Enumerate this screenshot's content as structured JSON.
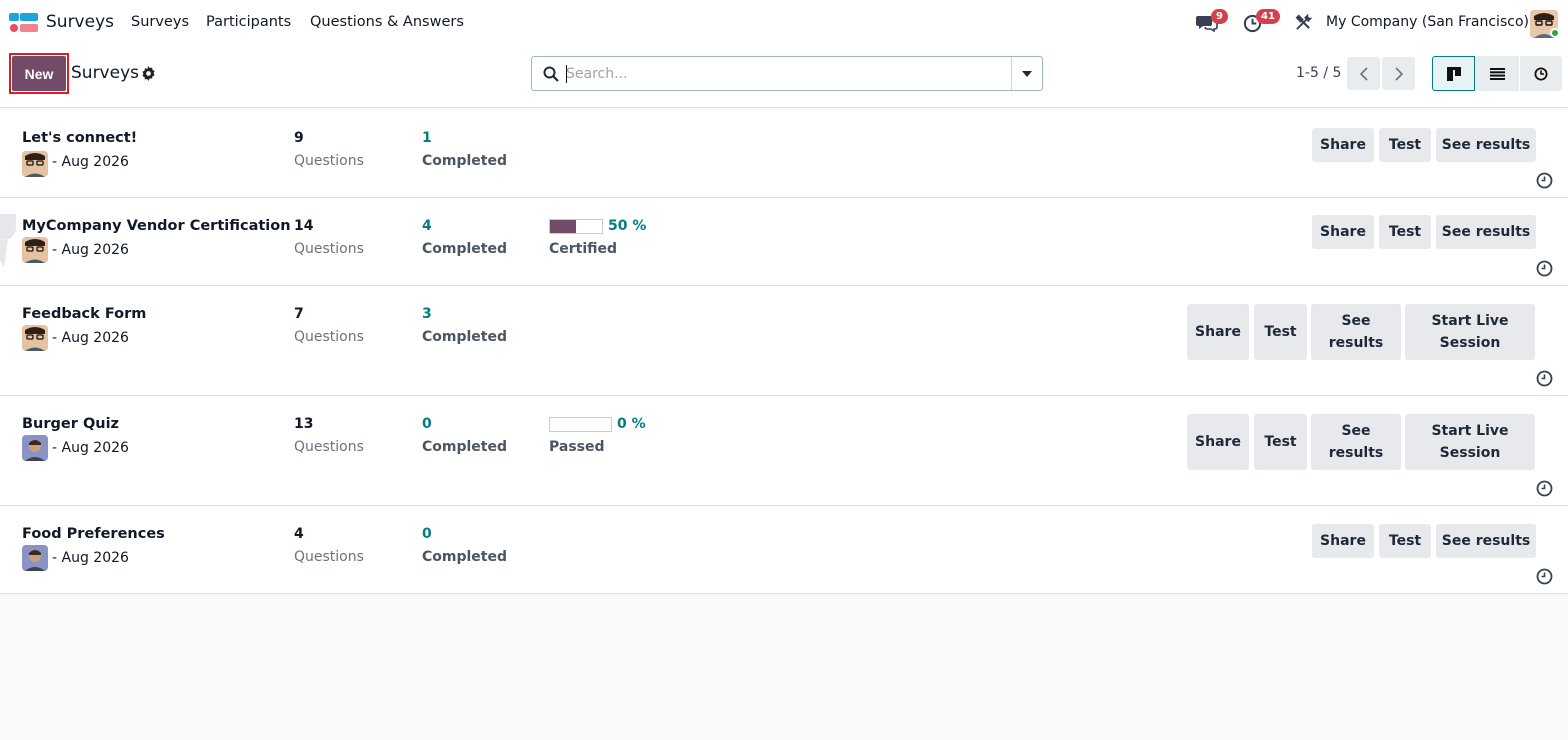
{
  "navbar": {
    "app_name": "Surveys",
    "menu": [
      "Surveys",
      "Participants",
      "Questions & Answers"
    ],
    "messages_count": "9",
    "activities_count": "41",
    "company": "My Company (San Francisco)"
  },
  "control": {
    "new_label": "New",
    "breadcrumb": "Surveys",
    "search_placeholder": "Search...",
    "pager": "1-5 / 5"
  },
  "records": [
    {
      "title": "Let's connect!",
      "date": "- Aug 2026",
      "questions": "9",
      "questions_label": "Questions",
      "completed": "1",
      "completed_label": "Completed",
      "actions": [
        "Share",
        "Test",
        "See results"
      ]
    },
    {
      "title": "MyCompany Vendor Certification",
      "date": "- Aug 2026",
      "questions": "14",
      "questions_label": "Questions",
      "completed": "4",
      "completed_label": "Completed",
      "success_pct": "50 %",
      "success_fraction": 0.5,
      "success_label": "Certified",
      "actions": [
        "Share",
        "Test",
        "See results"
      ]
    },
    {
      "title": "Feedback Form",
      "date": "- Aug 2026",
      "questions": "7",
      "questions_label": "Questions",
      "completed": "3",
      "completed_label": "Completed",
      "actions": [
        "Share",
        "Test",
        "See results",
        "Start Live Session"
      ]
    },
    {
      "title": "Burger Quiz",
      "date": "- Aug 2026",
      "questions": "13",
      "questions_label": "Questions",
      "completed": "0",
      "completed_label": "Completed",
      "success_pct": "0 %",
      "success_fraction": 0,
      "success_label": "Passed",
      "actions": [
        "Share",
        "Test",
        "See results",
        "Start Live Session"
      ]
    },
    {
      "title": "Food Preferences",
      "date": "- Aug 2026",
      "questions": "4",
      "questions_label": "Questions",
      "completed": "0",
      "completed_label": "Completed",
      "actions": [
        "Share",
        "Test",
        "See results"
      ]
    }
  ],
  "colors": {
    "brand": "#714b67",
    "teal": "#017e84",
    "badge": "#d2414c"
  },
  "icons": [
    "apps-icon",
    "messages-icon",
    "activity-clock-icon",
    "debug-tools-icon",
    "gear-icon",
    "search-icon",
    "caret-down-icon",
    "chevron-left-icon",
    "chevron-right-icon",
    "kanban-view-icon",
    "list-view-icon",
    "activity-view-icon",
    "clock-icon"
  ]
}
